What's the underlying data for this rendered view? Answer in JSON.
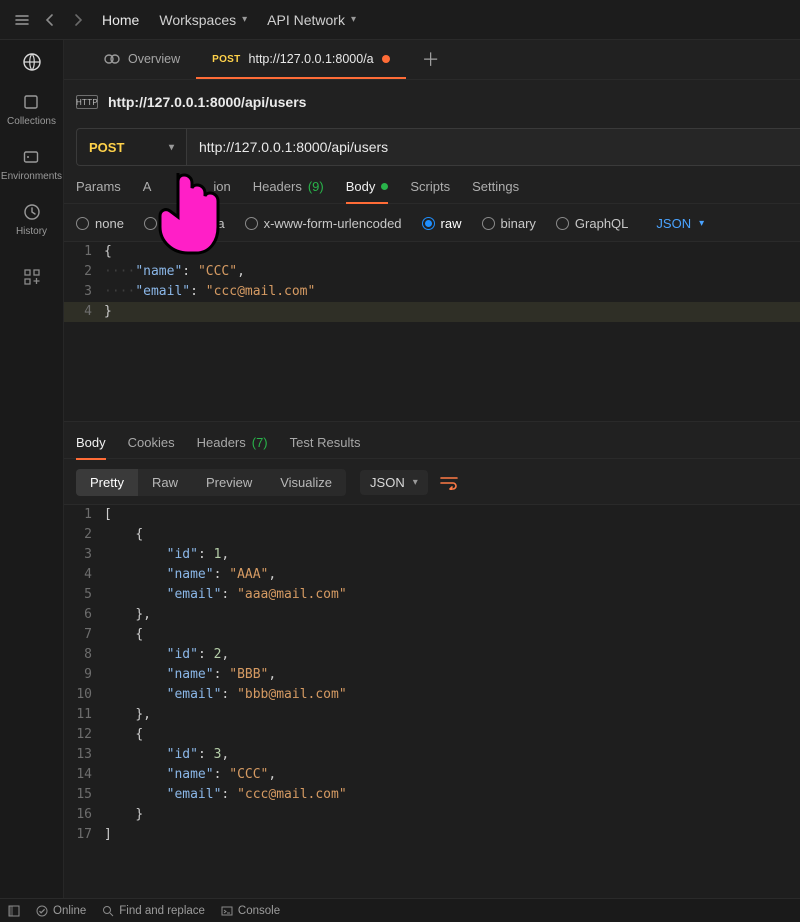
{
  "topnav": {
    "home": "Home",
    "workspaces": "Workspaces",
    "api_network": "API Network"
  },
  "rail": {
    "collections": "Collections",
    "environments": "Environments",
    "history": "History"
  },
  "tabs": {
    "overview": "Overview",
    "req_method": "POST",
    "req_label": "http://127.0.0.1:8000/a"
  },
  "address": {
    "badge": "HTTP",
    "full": "http://127.0.0.1:8000/api/users"
  },
  "request": {
    "method": "POST",
    "url": "http://127.0.0.1:8000/api/users"
  },
  "subtabs": {
    "params": "Params",
    "auth_pre": "A",
    "auth_post": "ion",
    "headers": "Headers",
    "headers_count": "(9)",
    "body": "Body",
    "scripts": "Scripts",
    "settings": "Settings"
  },
  "bodyopts": {
    "none": "none",
    "formdata_suffix": "ata",
    "urlencoded": "x-www-form-urlencoded",
    "raw": "raw",
    "binary": "binary",
    "graphql": "GraphQL",
    "json": "JSON"
  },
  "req_body": {
    "l1": "{",
    "l2_key": "\"name\"",
    "l2_val": "\"CCC\"",
    "l3_key": "\"email\"",
    "l3_val": "\"ccc@mail.com\"",
    "l4": "}"
  },
  "resp_tabs": {
    "body": "Body",
    "cookies": "Cookies",
    "headers": "Headers",
    "headers_count": "(7)",
    "tests": "Test Results"
  },
  "viewrow": {
    "pretty": "Pretty",
    "raw": "Raw",
    "preview": "Preview",
    "visualize": "Visualize",
    "format": "JSON"
  },
  "resp_body": {
    "open": "[",
    "items": [
      {
        "id": 1,
        "name": "\"AAA\"",
        "email": "\"aaa@mail.com\""
      },
      {
        "id": 2,
        "name": "\"BBB\"",
        "email": "\"bbb@mail.com\""
      },
      {
        "id": 3,
        "name": "\"CCC\"",
        "email": "\"ccc@mail.com\""
      }
    ],
    "close": "]"
  },
  "statusbar": {
    "online": "Online",
    "find": "Find and replace",
    "console": "Console"
  }
}
